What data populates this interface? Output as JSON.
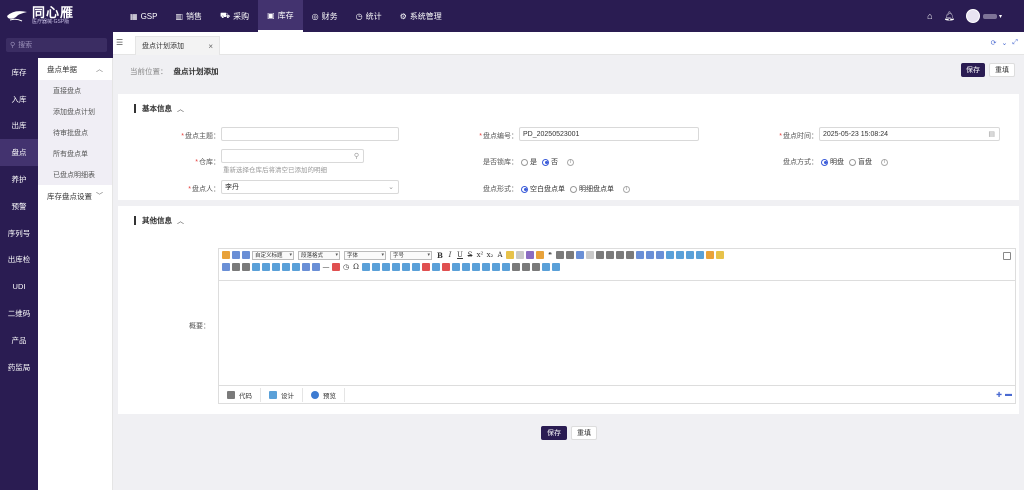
{
  "logo": {
    "name": "同心雁",
    "sub": "医疗器械·GSP版"
  },
  "topnav": [
    {
      "label": "GSP",
      "icon": "gsp-icon"
    },
    {
      "label": "销售",
      "icon": "chart-icon"
    },
    {
      "label": "采购",
      "icon": "cart-icon"
    },
    {
      "label": "库存",
      "icon": "inventory-icon"
    },
    {
      "label": "财务",
      "icon": "finance-icon"
    },
    {
      "label": "统计",
      "icon": "clock-icon"
    },
    {
      "label": "系统管理",
      "icon": "settings-icon"
    }
  ],
  "search": {
    "placeholder": "搜索"
  },
  "rail": [
    {
      "label": "库存"
    },
    {
      "label": "入库"
    },
    {
      "label": "出库"
    },
    {
      "label": "盘点"
    },
    {
      "label": "养护"
    },
    {
      "label": "预警"
    },
    {
      "label": "序列号"
    },
    {
      "label": "出库检"
    },
    {
      "label": "UDI"
    },
    {
      "label": "二维码"
    },
    {
      "label": "产品"
    },
    {
      "label": "药监局"
    }
  ],
  "submenu": {
    "group1": "盘点单据",
    "items": [
      "直接盘点",
      "添加盘点计划",
      "待审批盘点",
      "所有盘点单",
      "已盘点明细表"
    ],
    "group2": "库存盘点设置"
  },
  "tab": {
    "label": "盘点计划添加"
  },
  "breadcrumb": {
    "prefix": "当前位置：",
    "current": "盘点计划添加"
  },
  "buttons": {
    "save": "保存",
    "reset": "重填"
  },
  "basic": {
    "title": "基本信息",
    "subject_label": "盘点主题：",
    "subject_value": "",
    "warehouse_label": "仓库：",
    "warehouse_hint": "重新选择仓库后将清空已添加的明细",
    "person_label": "盘点人：",
    "person_value": "李丹",
    "number_label": "盘点编号：",
    "number_value": "PD_20250523001",
    "lock_label": "是否锁库：",
    "lock_yes": "是",
    "lock_no": "否",
    "form_label": "盘点形式：",
    "form_blank": "空白盘点单",
    "form_detail": "明细盘点单",
    "time_label": "盘点时间：",
    "time_value": "2025-05-23 15:08:24",
    "mode_label": "盘点方式：",
    "mode_open": "明盘",
    "mode_blind": "盲盘"
  },
  "other": {
    "title": "其他信息",
    "summary_label": "概要：",
    "toolbar": {
      "heading": "自定义标题",
      "para": "段落格式",
      "font": "字体",
      "size": "字号"
    },
    "tabs": [
      "代码",
      "设计",
      "预览"
    ]
  }
}
